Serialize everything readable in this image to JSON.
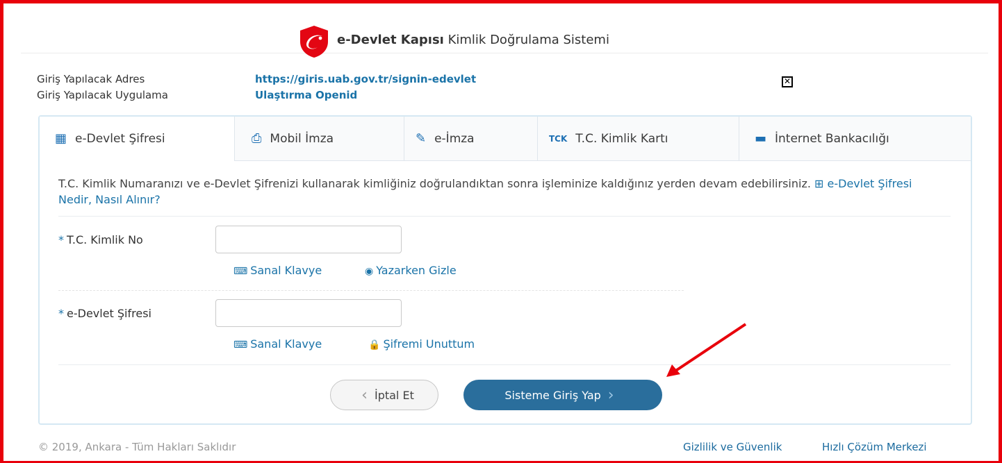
{
  "header": {
    "brand_bold": "e-Devlet Kapısı",
    "brand_rest": "Kimlik Doğrulama Sistemi"
  },
  "info": {
    "address_label": "Giriş Yapılacak Adres",
    "address_value": "https://giris.uab.gov.tr/signin-edevlet",
    "app_label": "Giriş Yapılacak Uygulama",
    "app_value": "Ulaştırma Openid"
  },
  "tabs": [
    {
      "label": "e-Devlet Şifresi",
      "icon": "keypad-icon",
      "active": true
    },
    {
      "label": "Mobil İmza",
      "icon": "mobile-signature-icon",
      "active": false
    },
    {
      "label": "e-İmza",
      "icon": "e-signature-icon",
      "active": false
    },
    {
      "label": "T.C. Kimlik Kartı",
      "icon": "id-card-icon",
      "active": false
    },
    {
      "label": "İnternet Bankacılığı",
      "icon": "bank-card-icon",
      "active": false
    }
  ],
  "description": {
    "text": "T.C. Kimlik Numaranızı ve e-Devlet Şifrenizi kullanarak kimliğiniz doğrulandıktan sonra işleminize kaldığınız yerden devam edebilirsiniz.",
    "help_link": "e-Devlet Şifresi Nedir, Nasıl Alınır?"
  },
  "form": {
    "tc_label": "T.C. Kimlik No",
    "tc_value": "",
    "password_label": "e-Devlet Şifresi",
    "password_value": "",
    "required_mark": "*",
    "virtual_keyboard": "Sanal Klavye",
    "hide_while_typing": "Yazarken Gizle",
    "forgot_password": "Şifremi Unuttum"
  },
  "buttons": {
    "cancel": "İptal Et",
    "login": "Sisteme Giriş Yap"
  },
  "footer": {
    "copyright": "© 2019, Ankara - Tüm Hakları Saklıdır",
    "privacy": "Gizlilik ve Güvenlik",
    "help_center": "Hızlı Çözüm Merkezi"
  },
  "colors": {
    "accent": "#1a73a8",
    "login_button": "#2a6e9c",
    "annotation_red": "#e8000b"
  }
}
